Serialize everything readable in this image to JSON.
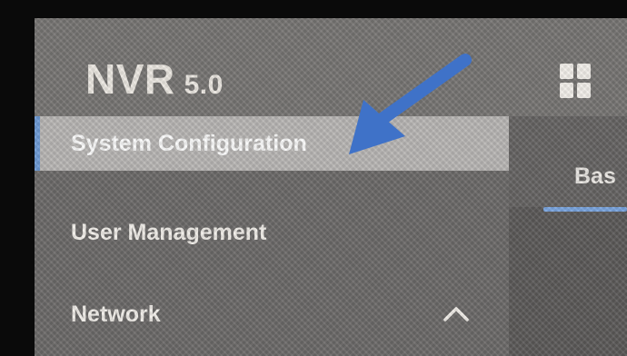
{
  "header": {
    "logo_main": "NVR",
    "logo_version": "5.0",
    "apps_icon": "grid-icon"
  },
  "sidebar": {
    "items": [
      {
        "label": "System Configuration",
        "active": true
      },
      {
        "label": "User Management",
        "active": false
      },
      {
        "label": "Network",
        "active": false,
        "icon": "chevron-up-icon"
      }
    ]
  },
  "main": {
    "active_tab_label": "Bas"
  },
  "annotation": {
    "icon": "arrow-icon",
    "color": "#3f72c8"
  },
  "colors": {
    "accent": "#6e9bd6",
    "active_item_bg": "#b8b6b4",
    "sidebar_bg": "#6c6a69"
  }
}
